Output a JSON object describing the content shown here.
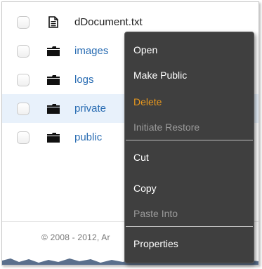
{
  "files": [
    {
      "name": "dDocument.txt",
      "type": "file",
      "icon": "document-icon",
      "selected": false
    },
    {
      "name": "images",
      "type": "folder",
      "icon": "folder-icon",
      "selected": false
    },
    {
      "name": "logs",
      "type": "folder",
      "icon": "folder-icon",
      "selected": false
    },
    {
      "name": "private",
      "type": "folder",
      "icon": "folder-icon",
      "selected": true
    },
    {
      "name": "public",
      "type": "folder",
      "icon": "folder-icon",
      "selected": false
    }
  ],
  "footer": {
    "copyright": "© 2008 - 2012, Ar"
  },
  "context_menu": {
    "items": [
      {
        "label": "Open",
        "state": "normal"
      },
      {
        "label": "Make Public",
        "state": "normal"
      },
      {
        "label": "Delete",
        "state": "danger"
      },
      {
        "label": "Initiate Restore",
        "state": "disabled"
      },
      {
        "label": "Cut",
        "state": "normal"
      },
      {
        "label": "Copy",
        "state": "normal"
      },
      {
        "label": "Paste Into",
        "state": "disabled"
      },
      {
        "label": "Properties",
        "state": "normal"
      }
    ]
  },
  "colors": {
    "menu_bg": "#3f3f3f",
    "danger": "#e8981e",
    "disabled": "#9a9a9a",
    "link": "#2a6db3",
    "selected_row": "#e8f1fb"
  }
}
